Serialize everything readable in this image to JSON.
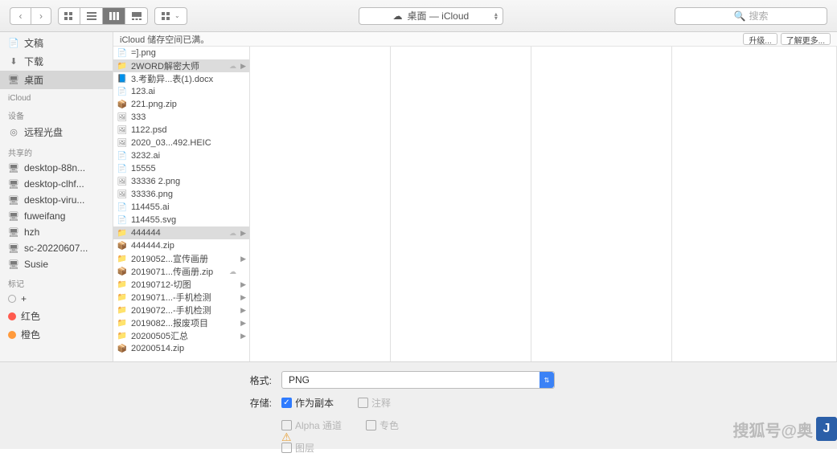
{
  "toolbar": {
    "path_icon": "cloud",
    "path_label": "桌面 — iCloud",
    "search_placeholder": "搜索"
  },
  "sidebar": {
    "favorites": [
      {
        "icon": "doc",
        "label": "文稿"
      },
      {
        "icon": "download",
        "label": "下载"
      },
      {
        "icon": "desktop",
        "label": "桌面",
        "selected": true
      }
    ],
    "icloud_header": "iCloud",
    "devices_header": "设备",
    "devices": [
      {
        "icon": "disc",
        "label": "远程光盘"
      }
    ],
    "shared_header": "共享的",
    "shared": [
      {
        "label": "desktop-88n..."
      },
      {
        "label": "desktop-clhf..."
      },
      {
        "label": "desktop-viru..."
      },
      {
        "label": "fuweifang"
      },
      {
        "label": "hzh"
      },
      {
        "label": "sc-20220607..."
      },
      {
        "label": "Susie"
      }
    ],
    "tags_header": "标记",
    "tags": [
      {
        "color": "",
        "label": "+"
      },
      {
        "color": "#ff5b4f",
        "label": "红色"
      },
      {
        "color": "#ff9a3c",
        "label": "橙色"
      }
    ]
  },
  "banner": {
    "text": "iCloud 储存空间已满。",
    "btn_upgrade": "升级...",
    "btn_more": "了解更多..."
  },
  "files": [
    {
      "icon": "doc",
      "label": "=].png"
    },
    {
      "icon": "folder",
      "label": "2WORD解密大师",
      "cloud": true,
      "arr": true,
      "sel": true
    },
    {
      "icon": "word",
      "label": "3.考勤异...表(1).docx"
    },
    {
      "icon": "ai",
      "label": "123.ai"
    },
    {
      "icon": "zip",
      "label": "221.png.zip"
    },
    {
      "icon": "img",
      "label": "333"
    },
    {
      "icon": "psd",
      "label": "1122.psd"
    },
    {
      "icon": "heic",
      "label": "2020_03...492.HEIC"
    },
    {
      "icon": "ai",
      "label": "3232.ai"
    },
    {
      "icon": "doc",
      "label": "15555"
    },
    {
      "icon": "img",
      "label": "33336 2.png"
    },
    {
      "icon": "img",
      "label": "33336.png"
    },
    {
      "icon": "ai",
      "label": "114455.ai"
    },
    {
      "icon": "svg",
      "label": "114455.svg"
    },
    {
      "icon": "folder",
      "label": "444444",
      "cloud": true,
      "arr": true,
      "sel": true
    },
    {
      "icon": "zip",
      "label": "444444.zip"
    },
    {
      "icon": "folder",
      "label": "2019052...宣传画册",
      "arr": true
    },
    {
      "icon": "zip",
      "label": "2019071...传画册.zip",
      "cloud": true
    },
    {
      "icon": "folder",
      "label": "20190712-切图",
      "arr": true
    },
    {
      "icon": "folder",
      "label": "2019071...-手机检测",
      "arr": true
    },
    {
      "icon": "folder",
      "label": "2019072...-手机检测",
      "arr": true
    },
    {
      "icon": "folder",
      "label": "2019082...报废项目",
      "arr": true
    },
    {
      "icon": "folder",
      "label": "20200505汇总",
      "arr": true
    },
    {
      "icon": "zip",
      "label": "20200514.zip"
    }
  ],
  "bottom": {
    "format_label": "格式:",
    "format_value": "PNG",
    "save_label": "存储:",
    "chk_copy": "作为副本",
    "chk_notes": "注释",
    "chk_alpha": "Alpha 通道",
    "chk_spot": "专色",
    "chk_layers": "图层"
  },
  "watermark": "搜狐号@奥"
}
